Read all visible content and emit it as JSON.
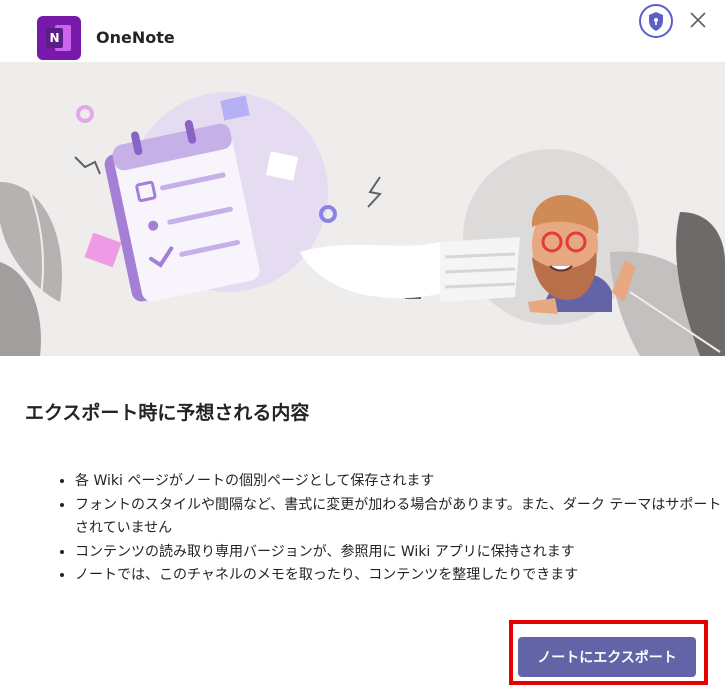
{
  "header": {
    "app_name": "OneNote",
    "app_icon_letter": "N"
  },
  "main": {
    "title": "エクスポート時に予想される内容",
    "bullets": [
      "各 Wiki ページがノートの個別ページとして保存されます",
      "フォントのスタイルや間隔など、書式に変更が加わる場合があります。また、ダーク テーマはサポートされていません",
      "コンテンツの読み取り専用バージョンが、参照用に Wiki アプリに保持されます",
      "ノートでは、このチャネルのメモを取ったり、コンテンツを整理したりできます"
    ]
  },
  "footer": {
    "export_label": "ノートにエクスポート"
  },
  "colors": {
    "accent": "#6264a7",
    "onenote": "#7719aa",
    "highlight": "#e60000",
    "hero_bg": "#efedec"
  },
  "icons": {
    "shield": "shield-icon",
    "close": "close-icon"
  }
}
